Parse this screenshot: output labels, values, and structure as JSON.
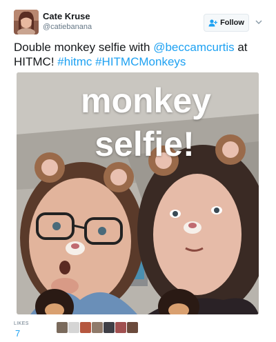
{
  "author": {
    "display_name": "Cate Kruse",
    "screen_name": "@catiebanana",
    "avatar_icon": "avatar-photo"
  },
  "actions": {
    "follow_label": "Follow",
    "follow_icon": "add-user-icon",
    "menu_icon": "chevron-down-icon"
  },
  "tweet": {
    "text_prefix": "Double monkey selfie with ",
    "mention": "@beccamcurtis",
    "text_middle": " at HITMC! ",
    "hashtag1": "#hitmc",
    "hashtag2": "#HITMCMonkeys"
  },
  "media": {
    "overlay_line1": "monkey",
    "overlay_line2": "selfie!"
  },
  "likes": {
    "label": "LIKES",
    "count": "7",
    "liker_colors": [
      "#7a6a5c",
      "#c8c8c8",
      "#b5573f",
      "#8f7a6a",
      "#3f3f46",
      "#a05050",
      "#6b4a3c"
    ]
  },
  "colors": {
    "link": "#1da1f2",
    "text": "#14171a",
    "muted": "#657786"
  }
}
